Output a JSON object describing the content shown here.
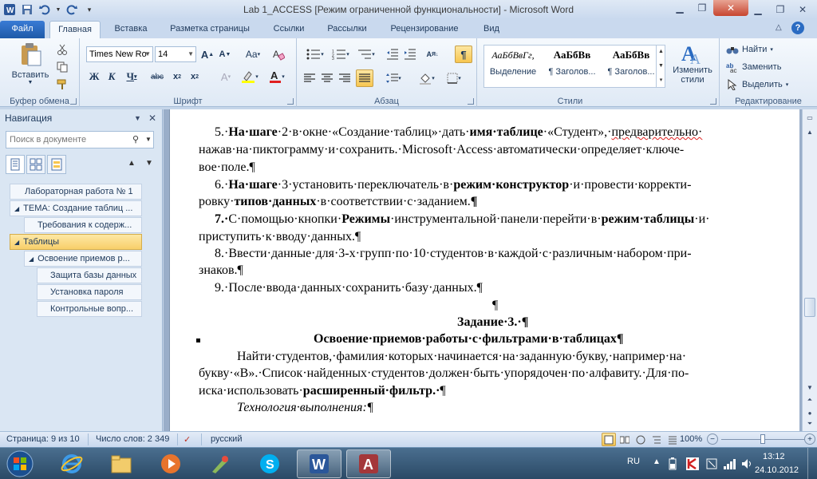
{
  "window": {
    "title": "Lab 1_ACCESS [Режим ограниченной функциональности]  -  Microsoft Word"
  },
  "tabs": [
    {
      "label": "Файл"
    },
    {
      "label": "Главная"
    },
    {
      "label": "Вставка"
    },
    {
      "label": "Разметка страницы"
    },
    {
      "label": "Ссылки"
    },
    {
      "label": "Рассылки"
    },
    {
      "label": "Рецензирование"
    },
    {
      "label": "Вид"
    }
  ],
  "ribbon": {
    "clipboard": {
      "paste_label": "Вставить",
      "group_label": "Буфер обмена"
    },
    "font": {
      "name": "Times New Ro",
      "size": "14",
      "group_label": "Шрифт"
    },
    "paragraph": {
      "group_label": "Абзац"
    },
    "styles": {
      "group_label": "Стили",
      "items": [
        {
          "sample": "АаБбВвГг,",
          "name": "Выделение"
        },
        {
          "sample": "АаБбВв",
          "name": "¶ Заголов..."
        },
        {
          "sample": "АаБбВв",
          "name": "¶ Заголов..."
        }
      ],
      "change_label": "Изменить стили"
    },
    "editing": {
      "group_label": "Редактирование",
      "find": "Найти",
      "replace": "Заменить",
      "select": "Выделить"
    }
  },
  "navigation": {
    "title": "Навигация",
    "search_placeholder": "Поиск в документе",
    "items": [
      {
        "label": "Лабораторная работа № 1"
      },
      {
        "label": "ТЕМА: Создание таблиц ..."
      },
      {
        "label": "Требования к содерж..."
      },
      {
        "label": "Таблицы"
      },
      {
        "label": "Освоение приемов р..."
      },
      {
        "label": "Защита базы данных"
      },
      {
        "label": "Установка пароля"
      },
      {
        "label": "Контрольные вопр..."
      }
    ]
  },
  "document": {
    "l1a": "5.·",
    "l1b": "На·шаге",
    "l1c": "·2·в·окне·«Создание·таблиц»·дать·",
    "l1d": "имя·таблице",
    "l1e": "·«Студент»,·",
    "l1f": "предварительно·",
    "l2": "нажав·на·пиктограмму·и·сохранить.·Microsoft·Access·автоматически·определяет·ключе-",
    "l3": "вое·поле.¶",
    "l4a": "6.·",
    "l4b": "На·шаге",
    "l4c": "·3·установить·переключатель·в·",
    "l4d": "режим·конструктор",
    "l4e": "·и·провести·корректи-",
    "l5a": "ровку·",
    "l5b": "типов·данных",
    "l5c": "·в·соответствии·с·заданием.",
    "l5d": "¶",
    "l6a": "7.·",
    "l6b": "С·помощью·кнопки·",
    "l6c": "Режимы",
    "l6d": "·инструментальной·панели·перейти·в·",
    "l6e": "режим·таблицы",
    "l6f": "·и·",
    "l7": "приступить·к·вводу·данных.¶",
    "l8": "8.·Ввести·данные·для·3-х·групп·по·10·студентов·в·каждой·с·различным·набором·при-",
    "l9": "знаков.¶",
    "l10": "9.·После·ввода·данных·сохранить·базу·данных.¶",
    "l11": "¶",
    "l12": "Задание·3.·¶",
    "l13": "Освоение·приемов·работы·с·фильтрами·в·таблицах¶",
    "l14": "Найти·студентов,·фамилия·которых·начинается·на·заданную·букву,·например·на·",
    "l15": "букву·«В».·Список·найденных·студентов·должен·быть·упорядочен·по·алфавиту.·Для·по-",
    "l16a": "иска·использовать·",
    "l16b": "расширенный·фильтр.·",
    "l16c": "¶",
    "l17": "Технология·выполнения:¶"
  },
  "status": {
    "page": "Страница: 9 из 10",
    "words": "Число слов: 2 349",
    "language": "русский",
    "zoom": "100%",
    "zoom_fraction": 0.5
  },
  "taskbar": {
    "lang": "RU",
    "time": "13:12",
    "date": "24.10.2012"
  },
  "colors": {
    "file_tab": "#2a6bc2",
    "selection": "#f8cf6a",
    "word_blue": "#2b579a",
    "access_red": "#a4373a"
  }
}
